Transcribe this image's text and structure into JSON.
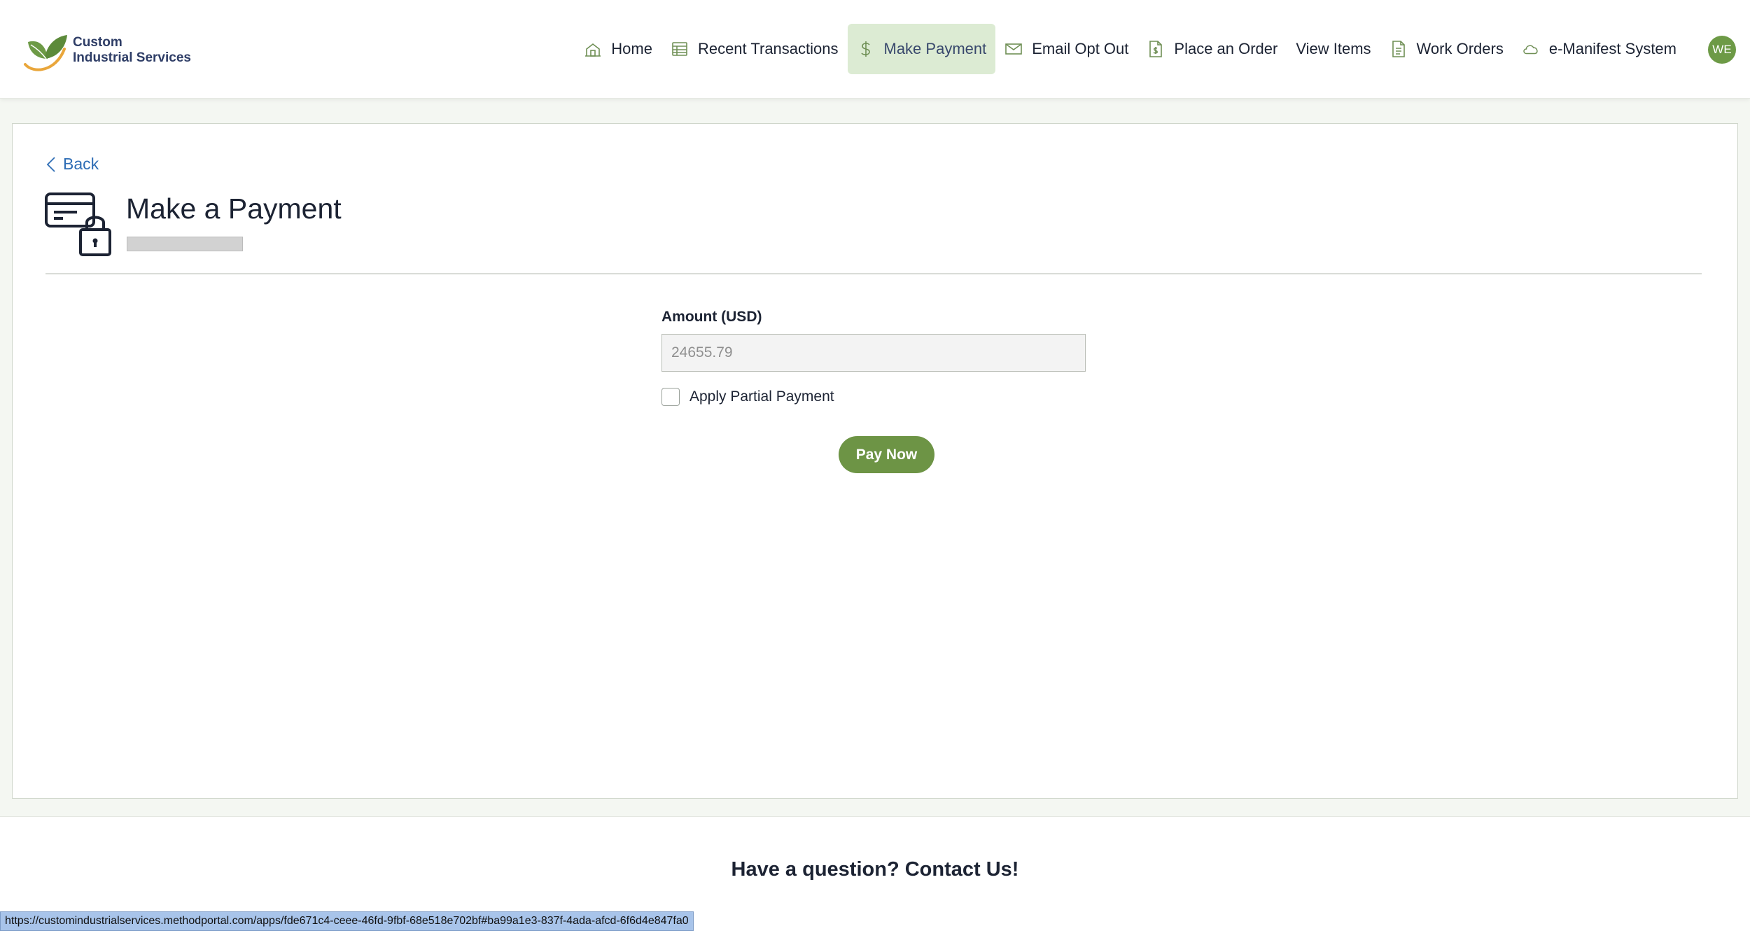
{
  "brand": {
    "line1": "Custom",
    "line2": "Industrial Services",
    "colors": {
      "leaf": "#6d9a46",
      "swoosh": "#e9a63b",
      "text": "#2e3d66"
    }
  },
  "nav": {
    "items": [
      {
        "label": "Home",
        "icon": "home-icon"
      },
      {
        "label": "Recent Transactions",
        "icon": "table-icon"
      },
      {
        "label": "Make Payment",
        "icon": "dollar-icon",
        "active": true
      },
      {
        "label": "Email Opt Out",
        "icon": "mail-icon"
      },
      {
        "label": "Place an Order",
        "icon": "order-document-icon"
      },
      {
        "label": "View Items",
        "icon": ""
      },
      {
        "label": "Work Orders",
        "icon": "document-icon"
      },
      {
        "label": "e-Manifest System",
        "icon": "cloud-icon"
      }
    ],
    "avatar_initials": "WE",
    "active_bg": "#dcebd3"
  },
  "page": {
    "back_label": "Back",
    "title": "Make a Payment",
    "title_icon": "card-lock-icon"
  },
  "form": {
    "amount_label": "Amount (USD)",
    "amount_placeholder": "24655.79",
    "partial_label": "Apply Partial Payment",
    "partial_checked": false,
    "pay_button": "Pay Now",
    "button_color": "#6d9445"
  },
  "footer": {
    "contact": "Have a question? Contact Us!"
  },
  "status_bar": {
    "url": "https://customindustrialservices.methodportal.com/apps/fde671c4-ceee-46fd-9fbf-68e518e702bf#ba99a1e3-837f-4ada-afcd-6f6d4e847fa0"
  }
}
